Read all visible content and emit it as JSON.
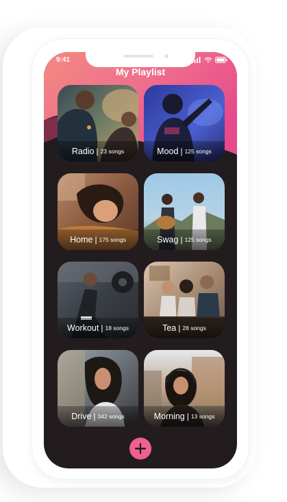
{
  "status_bar": {
    "time": "9:41"
  },
  "header": {
    "title": "My Playlist"
  },
  "playlists": [
    {
      "name": "Radio",
      "count": "23 songs",
      "palette": "warm-street"
    },
    {
      "name": "Mood",
      "count": "125 songs",
      "palette": "blue-concert"
    },
    {
      "name": "Home",
      "count": "175 songs",
      "palette": "sleeping-girl"
    },
    {
      "name": "Swag",
      "count": "125 songs",
      "palette": "guitar-duo"
    },
    {
      "name": "Workout",
      "count": "18 songs",
      "palette": "gym"
    },
    {
      "name": "Tea",
      "count": "28 songs",
      "palette": "cafe"
    },
    {
      "name": "Drive",
      "count": "342 songs",
      "palette": "street-girl"
    },
    {
      "name": "Morning",
      "count": "13 songs",
      "palette": "city-headphones"
    }
  ],
  "colors": {
    "header_gradient_start": "#f0708a",
    "header_gradient_end": "#e8458a",
    "background": "#231c1f",
    "fab": "#f0608f"
  },
  "icons": [
    "signal-icon",
    "wifi-icon",
    "battery-icon",
    "plus-icon"
  ]
}
